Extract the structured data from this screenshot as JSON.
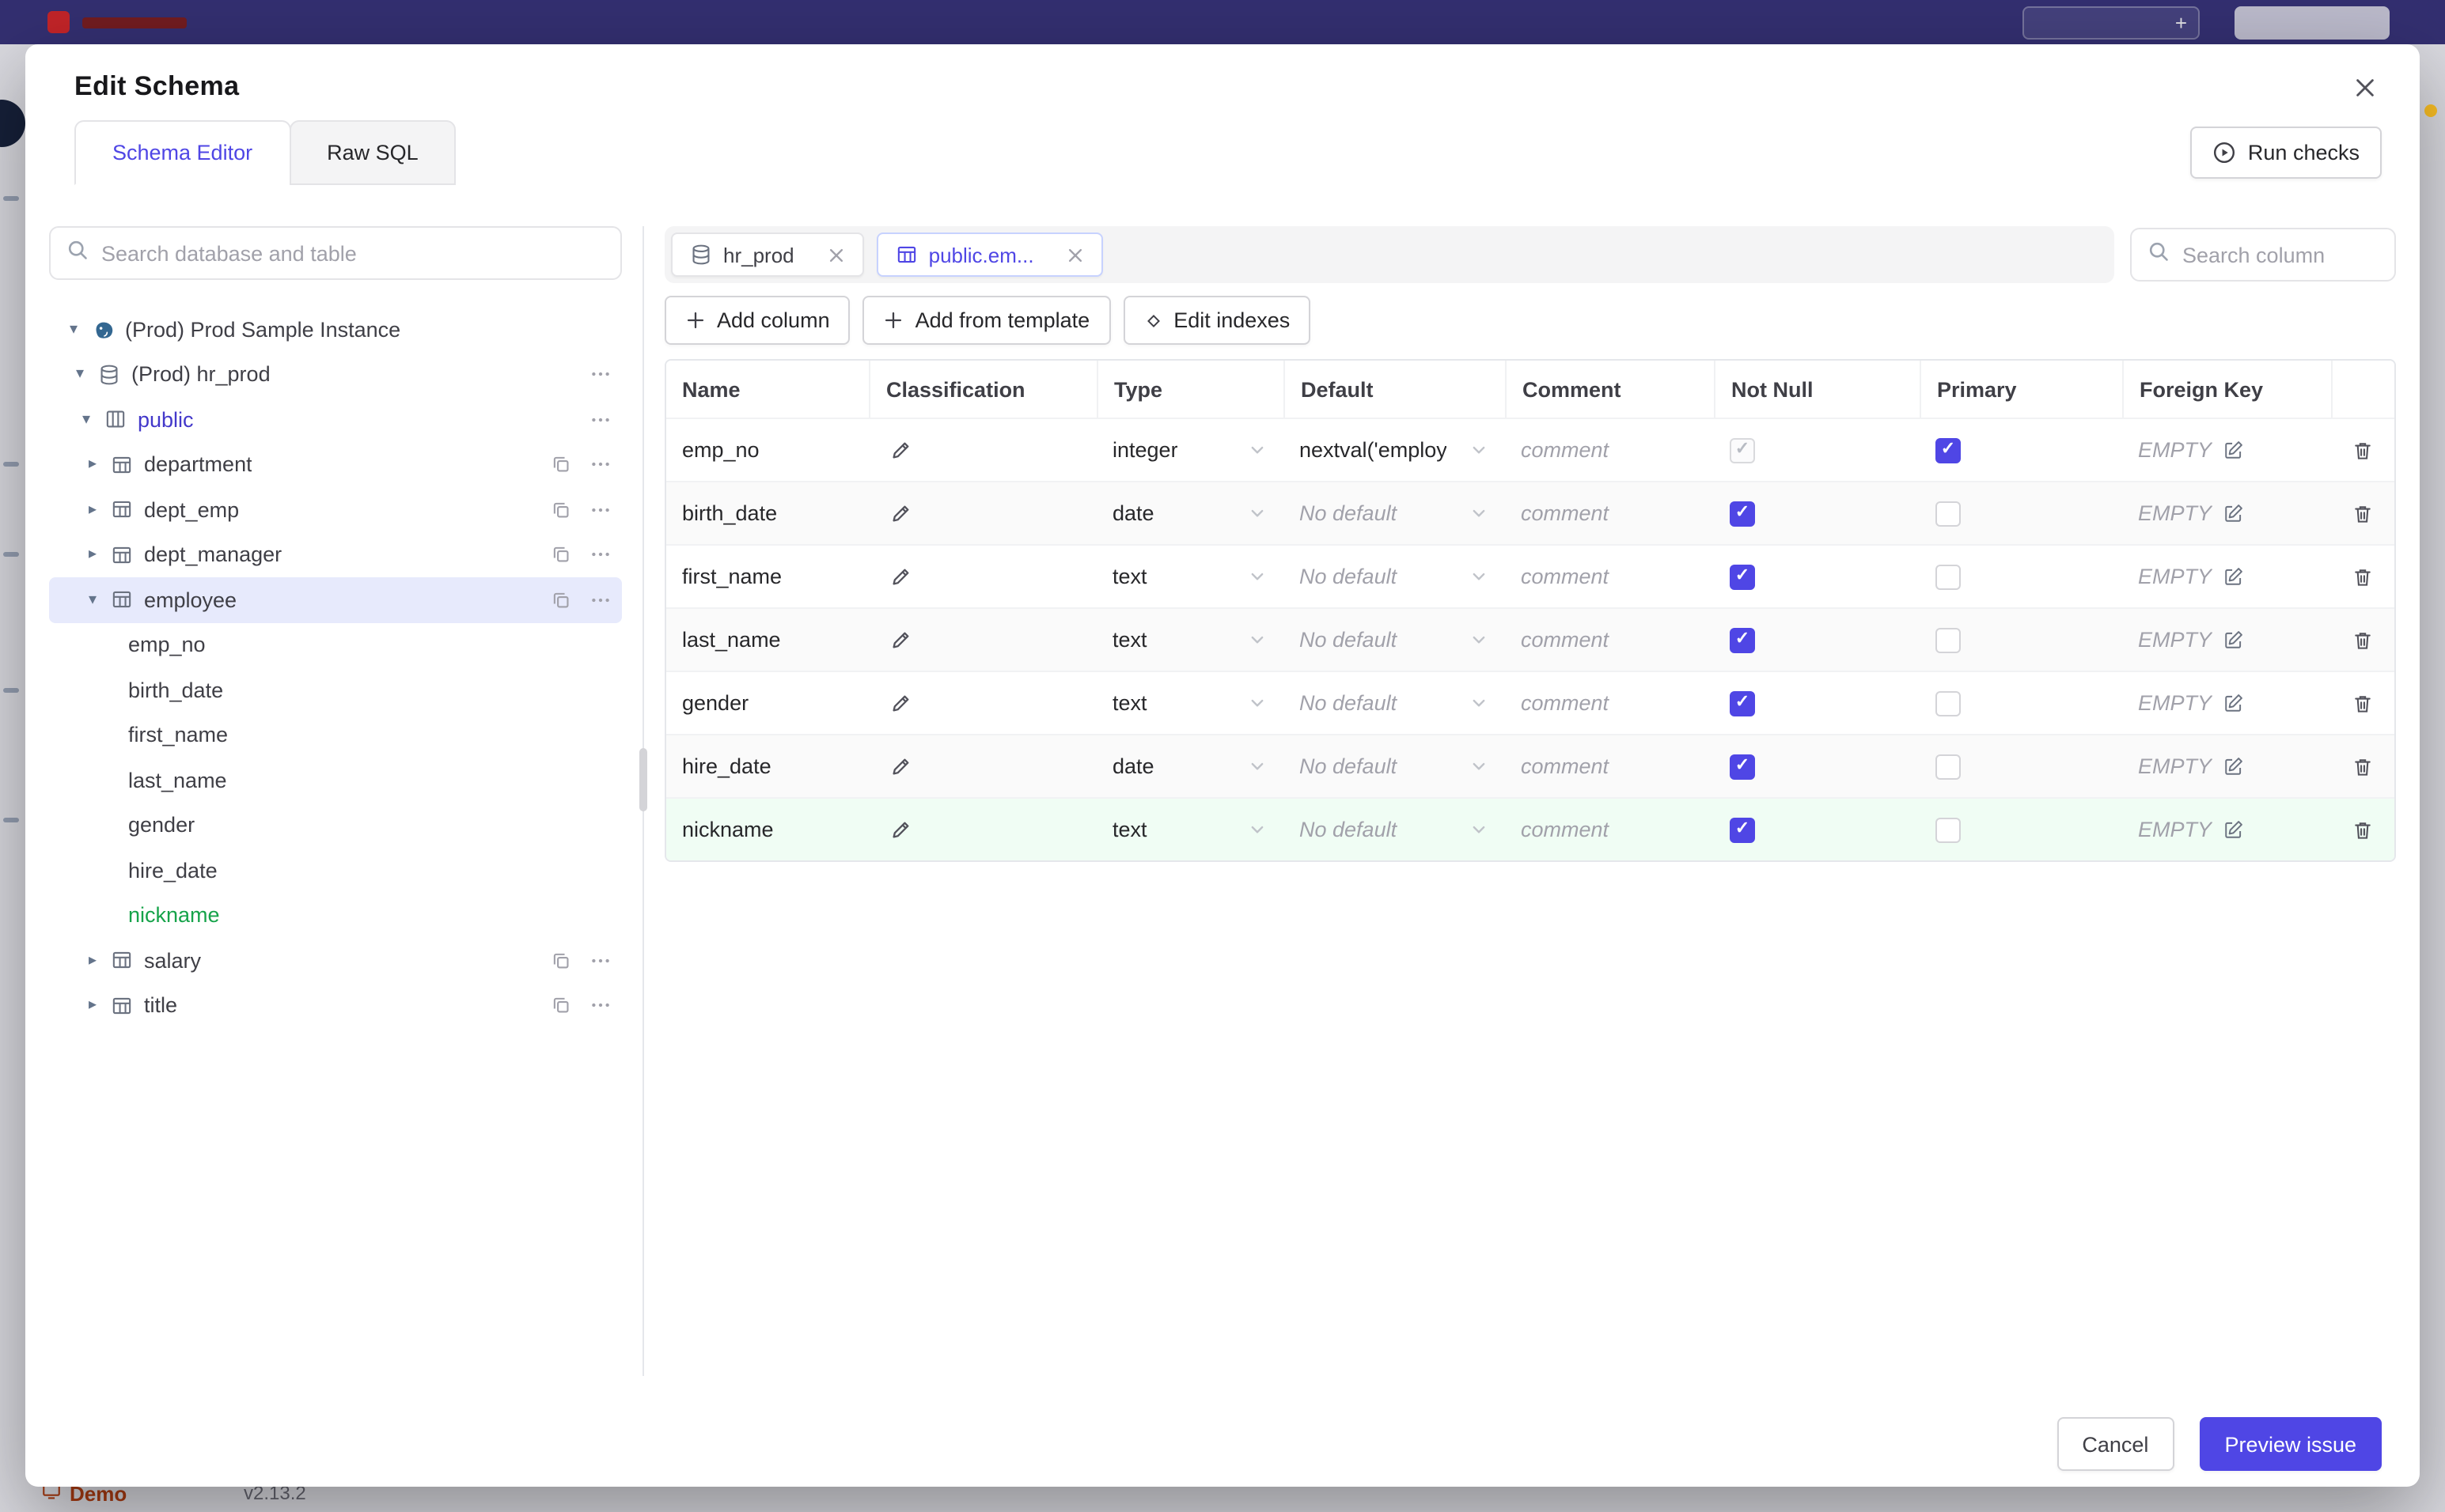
{
  "topbar": {
    "plus_glyph": "+"
  },
  "backdrop": {
    "demo_label": "Demo",
    "version": "v2.13.2"
  },
  "modal": {
    "title": "Edit Schema",
    "tabs": [
      {
        "label": "Schema Editor"
      },
      {
        "label": "Raw SQL"
      }
    ],
    "run_checks_label": "Run checks",
    "cancel_label": "Cancel",
    "preview_issue_label": "Preview issue"
  },
  "sidebar": {
    "search_placeholder": "Search database and table",
    "tree": [
      {
        "label": "(Prod) Prod Sample Instance",
        "level": 0,
        "caret": "down",
        "icon": "postgres",
        "copy": false,
        "more": false
      },
      {
        "label": "(Prod) hr_prod",
        "level": 1,
        "caret": "down",
        "icon": "database",
        "copy": false,
        "more": true
      },
      {
        "label": "public",
        "level": 2,
        "caret": "down",
        "icon": "schema",
        "copy": false,
        "more": true,
        "emph": true
      },
      {
        "label": "department",
        "level": 3,
        "caret": "right",
        "icon": "table",
        "copy": true,
        "more": true
      },
      {
        "label": "dept_emp",
        "level": 3,
        "caret": "right",
        "icon": "table",
        "copy": true,
        "more": true
      },
      {
        "label": "dept_manager",
        "level": 3,
        "caret": "right",
        "icon": "table",
        "copy": true,
        "more": true
      },
      {
        "label": "employee",
        "level": 3,
        "caret": "down",
        "icon": "table",
        "copy": true,
        "more": true,
        "selected": true
      },
      {
        "label": "emp_no",
        "level": 4,
        "icon": "none"
      },
      {
        "label": "birth_date",
        "level": 4,
        "icon": "none"
      },
      {
        "label": "first_name",
        "level": 4,
        "icon": "none"
      },
      {
        "label": "last_name",
        "level": 4,
        "icon": "none"
      },
      {
        "label": "gender",
        "level": 4,
        "icon": "none"
      },
      {
        "label": "hire_date",
        "level": 4,
        "icon": "none"
      },
      {
        "label": "nickname",
        "level": 4,
        "icon": "none",
        "green": true
      },
      {
        "label": "salary",
        "level": 3,
        "caret": "right",
        "icon": "table",
        "copy": true,
        "more": true
      },
      {
        "label": "title",
        "level": 3,
        "caret": "right",
        "icon": "table",
        "copy": true,
        "more": true
      }
    ]
  },
  "main": {
    "chips": [
      {
        "label": "hr_prod"
      },
      {
        "label": "public.em..."
      }
    ],
    "column_search_placeholder": "Search column",
    "toolbar": [
      {
        "label": "Add column"
      },
      {
        "label": "Add from template"
      },
      {
        "label": "Edit indexes"
      }
    ],
    "table": {
      "headers": [
        "Name",
        "Classification",
        "Type",
        "Default",
        "Comment",
        "Not Null",
        "Primary",
        "Foreign Key"
      ],
      "comment_placeholder": "comment",
      "no_default_label": "No default",
      "foreign_key_value": "EMPTY",
      "rows": [
        {
          "name": "emp_no",
          "type": "integer",
          "default": "nextval('employ",
          "has_default": true,
          "not_null": "checked_disabled",
          "primary": true,
          "is_new": false
        },
        {
          "name": "birth_date",
          "type": "date",
          "has_default": false,
          "not_null": "checked",
          "primary": false,
          "is_new": false
        },
        {
          "name": "first_name",
          "type": "text",
          "has_default": false,
          "not_null": "checked",
          "primary": false,
          "is_new": false
        },
        {
          "name": "last_name",
          "type": "text",
          "has_default": false,
          "not_null": "checked",
          "primary": false,
          "is_new": false
        },
        {
          "name": "gender",
          "type": "text",
          "has_default": false,
          "not_null": "checked",
          "primary": false,
          "is_new": false
        },
        {
          "name": "hire_date",
          "type": "date",
          "has_default": false,
          "not_null": "checked",
          "primary": false,
          "is_new": false
        },
        {
          "name": "nickname",
          "type": "text",
          "has_default": false,
          "not_null": "checked",
          "primary": false,
          "is_new": true
        }
      ]
    }
  }
}
